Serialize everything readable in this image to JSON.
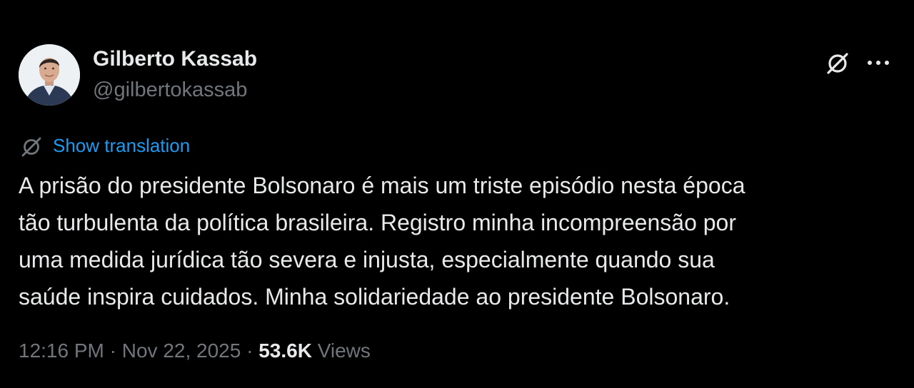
{
  "author": {
    "display_name": "Gilberto Kassab",
    "handle": "@gilbertokassab"
  },
  "translation": {
    "label": "Show translation"
  },
  "tweet": {
    "text": "A prisão do presidente Bolsonaro é mais um triste episódio nesta época\ntão turbulenta da política brasileira. Registro minha incompreensão por\numa medida jurídica tão severa e injusta, especialmente quando sua\nsaúde inspira cuidados. Minha solidariedade ao presidente Bolsonaro."
  },
  "meta": {
    "time": "12:16 PM",
    "separator": "·",
    "date": "Nov 22, 2025",
    "views_count": "53.6K",
    "views_label": "Views"
  },
  "icons": {
    "grok": "grok-icon",
    "more": "more-icon",
    "translate": "translate-icon"
  },
  "colors": {
    "background": "#000000",
    "text_primary": "#e7e9ea",
    "text_secondary": "#71767b",
    "link": "#1d9bf0"
  }
}
